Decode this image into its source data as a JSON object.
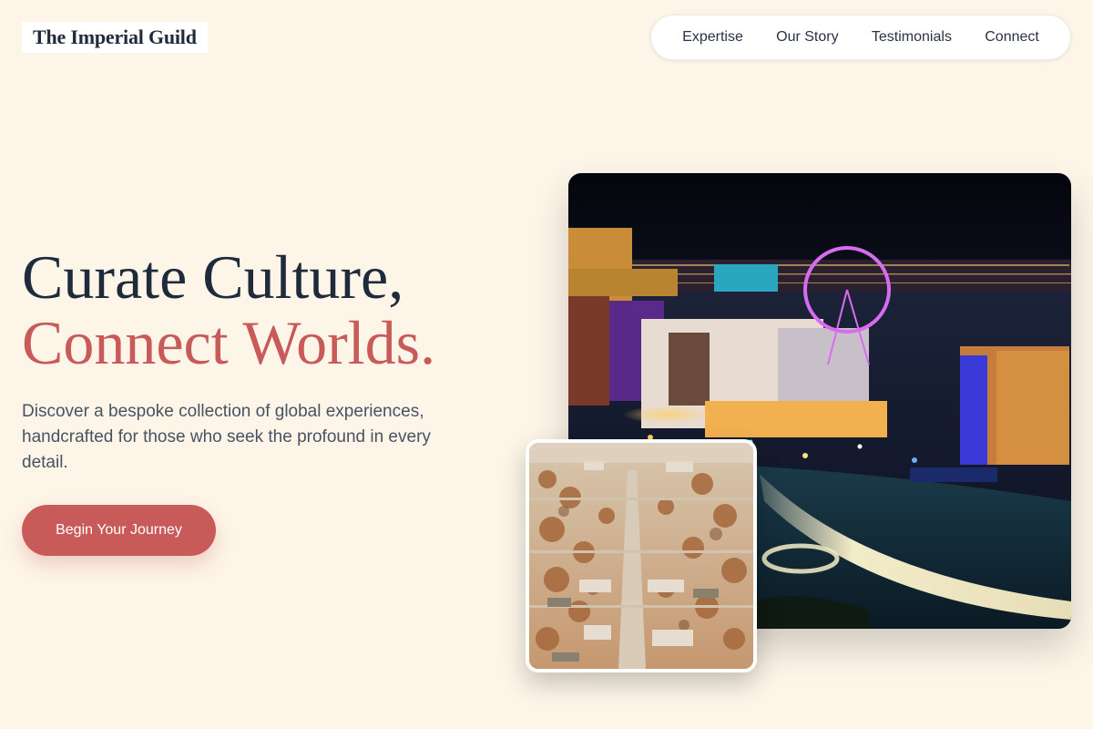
{
  "brand": {
    "name": "The Imperial Guild"
  },
  "nav": {
    "items": [
      {
        "label": "Expertise"
      },
      {
        "label": "Our Story"
      },
      {
        "label": "Testimonials"
      },
      {
        "label": "Connect"
      }
    ]
  },
  "hero": {
    "headline_line1": "Curate Culture,",
    "headline_line2": "Connect Worlds.",
    "subtext": "Discover a bespoke collection of global experiences, handcrafted for those who seek the profound in every detail.",
    "cta_label": "Begin Your Journey"
  },
  "colors": {
    "background": "#fdf5e8",
    "accent": "#c85a5a",
    "text_dark": "#1f2a3a",
    "text_muted": "#4a5263"
  }
}
